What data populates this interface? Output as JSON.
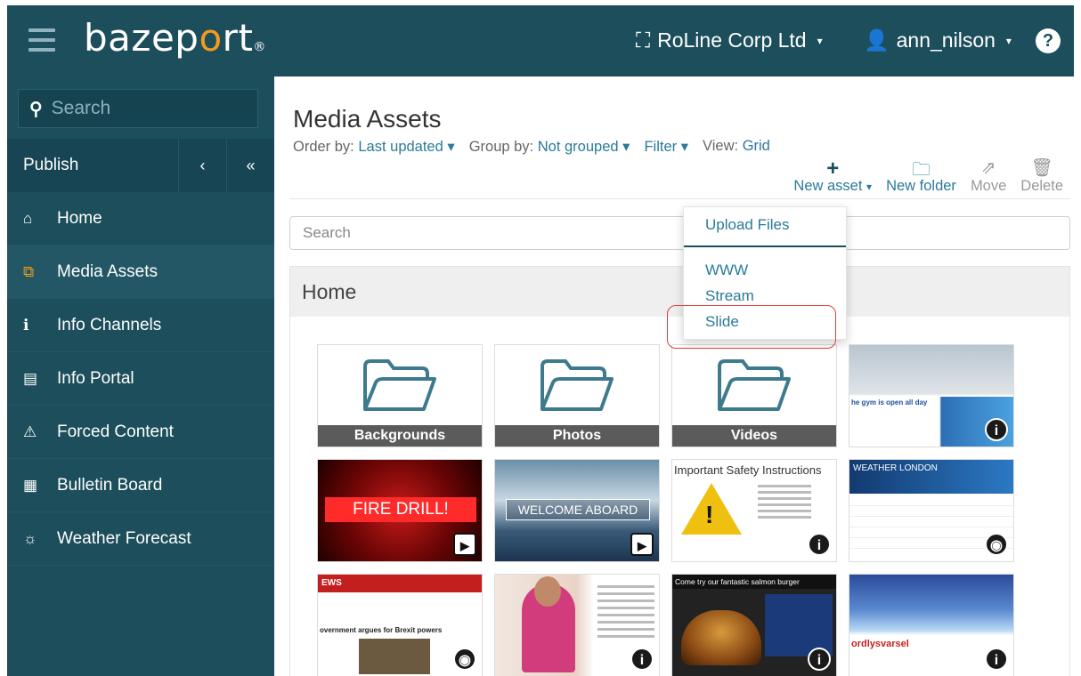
{
  "header": {
    "logo": "bazeport",
    "company": "RoLine Corp Ltd",
    "user": "ann_nilson",
    "help": "?"
  },
  "sidebar": {
    "search_placeholder": "Search",
    "publish_label": "Publish",
    "collapse_label": "‹",
    "double_collapse_label": "«",
    "items": [
      {
        "label": "Home",
        "icon": "home-icon"
      },
      {
        "label": "Media Assets",
        "icon": "media-assets-icon"
      },
      {
        "label": "Info Channels",
        "icon": "info-icon"
      },
      {
        "label": "Info Portal",
        "icon": "portal-icon"
      },
      {
        "label": "Forced Content",
        "icon": "warning-icon"
      },
      {
        "label": "Bulletin Board",
        "icon": "bulletin-icon"
      },
      {
        "label": "Weather Forecast",
        "icon": "sun-icon"
      }
    ],
    "active_item": "Media Assets"
  },
  "main": {
    "title": "Media Assets",
    "order_label": "Order by:",
    "order_value": "Last updated",
    "group_label": "Group by:",
    "group_value": "Not grouped",
    "filter_label": "Filter",
    "view_label": "View:",
    "view_value": "Grid",
    "toolbar": {
      "new_asset": "New asset",
      "new_folder": "New folder",
      "move": "Move",
      "delete": "Delete"
    },
    "search_placeholder": "Search",
    "panel_title": "Home",
    "folders": [
      "Backgrounds",
      "Photos",
      "Videos"
    ],
    "thumbnails": {
      "gym": "he gym is open all day",
      "fire": "FIRE DRILL!",
      "ship": "WELCOME ABOARD",
      "safety": "Important Safety Instructions",
      "weather": "WEATHER LONDON",
      "news": "EWS",
      "news_headline": "overnment argues for Brexit powers",
      "burger": "Come try our fantastic salmon burger",
      "aurora": "ordlysvarsel"
    }
  },
  "dropdown": {
    "items": [
      "Upload Files",
      "WWW",
      "Stream",
      "Slide"
    ],
    "highlighted": "Slide"
  },
  "colors": {
    "primary": "#1c4e5c",
    "accent": "#f39a1e",
    "link": "#2a7a9a",
    "highlight": "#d9433a"
  }
}
